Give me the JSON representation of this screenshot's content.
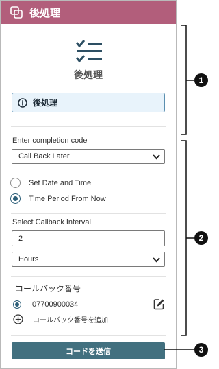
{
  "header": {
    "title": "後処理",
    "icon": "wrap-up-icon"
  },
  "task": {
    "icon": "checklist-icon",
    "title": "後処理"
  },
  "info": {
    "icon": "info-icon",
    "text": "後処理"
  },
  "completion": {
    "label": "Enter completion code",
    "selected": "Call Back Later"
  },
  "schedule": {
    "options": [
      {
        "label": "Set Date and Time",
        "selected": false
      },
      {
        "label": "Time Period From Now",
        "selected": true
      }
    ]
  },
  "interval": {
    "label": "Select Callback Interval",
    "value": "2",
    "unit": "Hours"
  },
  "callback": {
    "title": "コールバック番号",
    "number": "07700900034",
    "add_label": "コールバック番号を追加"
  },
  "submit_label": "コードを送信",
  "callouts": [
    "1",
    "2",
    "3"
  ],
  "colors": {
    "header": "#b25e7b",
    "accent": "#2d5f79",
    "button": "#42707f",
    "info_bg": "#e8f3fb"
  }
}
